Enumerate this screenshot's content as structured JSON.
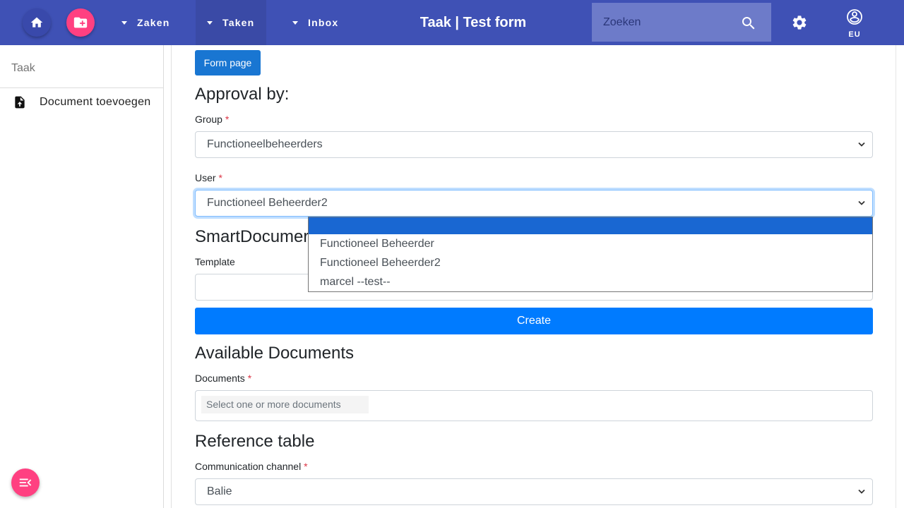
{
  "header": {
    "nav": [
      "Zaken",
      "Taken",
      "Inbox"
    ],
    "title": "Taak | Test form",
    "search_placeholder": "Zoeken",
    "account_label": "EU",
    "colors": {
      "primary": "#3f51b5",
      "accent": "#ff4081"
    }
  },
  "sidebar": {
    "header": "Taak",
    "items": [
      {
        "label": "Document toevoegen",
        "icon": "file-upload-icon"
      }
    ]
  },
  "form": {
    "form_page_button": "Form page",
    "approval_heading": "Approval by:",
    "group_label": "Group",
    "group_value": "Functioneelbeheerders",
    "user_label": "User",
    "user_value": "Functioneel Beheerder2",
    "smartdocuments_heading": "SmartDocumer",
    "template_label": "Template",
    "template_value": "",
    "create_button": "Create",
    "available_heading": "Available Documents",
    "documents_label": "Documents",
    "documents_placeholder": "Select one or more documents",
    "reference_heading": "Reference table",
    "channel_label": "Communication channel",
    "channel_value": "Balie",
    "required_mark": "*"
  },
  "user_dropdown": {
    "options": [
      "",
      "Functioneel Beheerder",
      "Functioneel Beheerder2",
      "marcel --test--"
    ],
    "highlighted_index": 0
  }
}
